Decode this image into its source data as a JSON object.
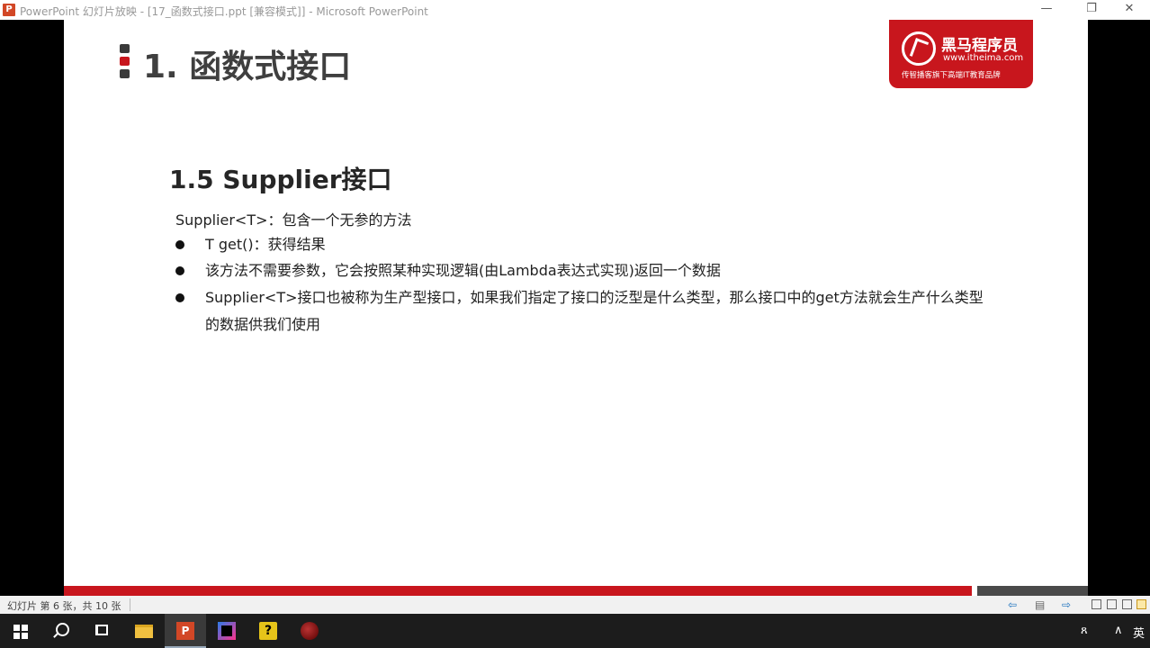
{
  "window": {
    "app_icon_letter": "P",
    "title": "PowerPoint 幻灯片放映 - [17_函数式接口.ppt [兼容模式]] - Microsoft PowerPoint",
    "minimize": "—",
    "restore": "❐",
    "close": "✕"
  },
  "slide": {
    "title": "1. 函数式接口",
    "logo": {
      "name": "黑马程序员",
      "url": "www.itheima.com",
      "slogan": "传智播客旗下高端IT教育品牌"
    },
    "subtitle": "1.5 Supplier接口",
    "intro": "Supplier<T>：包含一个无参的方法",
    "bullets": [
      "T get()：获得结果",
      "该方法不需要参数，它会按照某种实现逻辑(由Lambda表达式实现)返回一个数据",
      "Supplier<T>接口也被称为生产型接口，如果我们指定了接口的泛型是什么类型，那么接口中的get方法就会生产什么类型的数据供我们使用"
    ],
    "accent_color": "#c8161d"
  },
  "statusbar": {
    "slide_counter": "幻灯片 第 6 张，共 10 张",
    "prev_icon": "⇦",
    "menu_icon": "▤",
    "next_icon": "⇨"
  },
  "taskbar": {
    "items": [
      "start-icon",
      "search-icon",
      "task-view-icon",
      "file-explorer-icon",
      "powerpoint-icon",
      "intellij-icon",
      "help-icon",
      "recorder-icon"
    ],
    "ppt_letter": "P",
    "help_glyph": "?",
    "tray_person": "ጸ",
    "tray_chevron": "∧",
    "language": "英"
  }
}
